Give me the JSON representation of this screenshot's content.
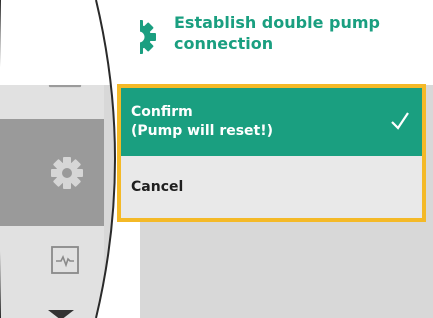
{
  "header": {
    "title": "Establish double pump\nconnection",
    "icon": "gear-icon",
    "title_color": "#1a9f80"
  },
  "rail": {
    "items": [
      {
        "name": "home-icon",
        "selected": false
      },
      {
        "name": "settings-gear-icon",
        "selected": true
      },
      {
        "name": "diagnostics-icon",
        "selected": false
      }
    ],
    "scroll": "chevron-down-icon"
  },
  "dialog": {
    "options": [
      {
        "label": "Confirm\n(Pump will reset!)",
        "selected": true,
        "icon": "checkmark-icon"
      },
      {
        "label": "Cancel",
        "selected": false
      }
    ],
    "focus_color": "#f4b927",
    "selected_color": "#1a9f80"
  }
}
